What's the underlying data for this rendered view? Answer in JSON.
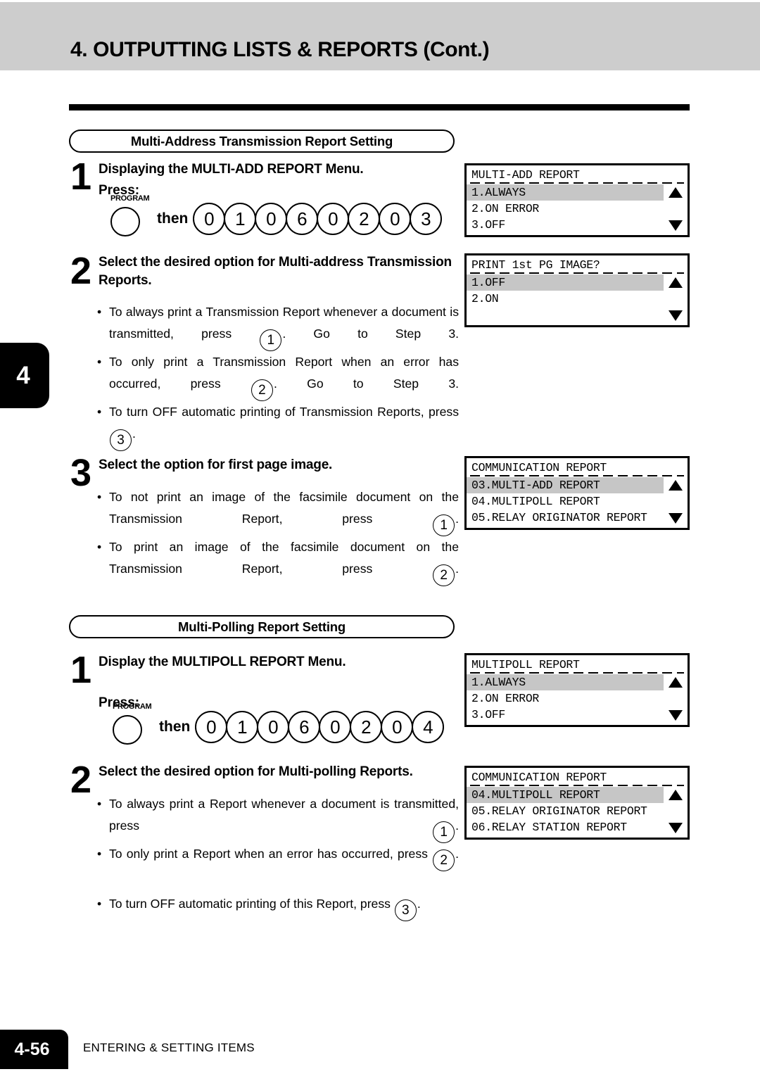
{
  "header": {
    "title": "4. OUTPUTTING LISTS & REPORTS (Cont.)"
  },
  "chapter_tab": "4",
  "sections": [
    {
      "pill_label": "Multi-Address Transmission Report Setting",
      "steps": [
        {
          "number": "1",
          "heading": "Displaying the MULTI-ADD REPORT Menu.",
          "press_label": "Press:",
          "program_key_label": "PROGRAM",
          "then_label": "then",
          "key_sequence": [
            "0",
            "1",
            "0",
            "6",
            "0",
            "2",
            "0",
            "3"
          ]
        },
        {
          "number": "2",
          "heading": "Select the desired option for Multi-address Transmission Reports.",
          "bullets": [
            {
              "pre": "To always print a Transmission Report whenever a document is transmitted, press ",
              "key": "1",
              "post": ".  Go to Step 3."
            },
            {
              "pre": "To only print a Transmission Report when an error has occurred, press ",
              "key": "2",
              "post": ".  Go to Step 3."
            },
            {
              "pre": "To turn OFF automatic printing of Transmission Reports, press ",
              "key": "3",
              "post": "."
            }
          ]
        },
        {
          "number": "3",
          "heading": "Select the option for first page image.",
          "bullets": [
            {
              "pre": "To not print an image of the facsimile document on the Transmission Report, press ",
              "key": "1",
              "post": "."
            },
            {
              "pre": "To print an image of the facsimile document on the Transmission Report, press ",
              "key": "2",
              "post": "."
            }
          ]
        }
      ]
    },
    {
      "pill_label": "Multi-Polling Report Setting",
      "steps": [
        {
          "number": "1",
          "heading": "Display the MULTIPOLL REPORT Menu.",
          "press_label": "Press:",
          "program_key_label": "PROGRAM",
          "then_label": "then",
          "key_sequence": [
            "0",
            "1",
            "0",
            "6",
            "0",
            "2",
            "0",
            "4"
          ]
        },
        {
          "number": "2",
          "heading": "Select the desired option for Multi-polling Reports.",
          "bullets": [
            {
              "pre": "To always print a Report whenever a document is transmitted, press ",
              "key": "1",
              "post": "."
            },
            {
              "pre": "To only print a Report when an error has occurred, press ",
              "key": "2",
              "post": "."
            },
            {
              "pre": "To turn OFF automatic printing of this Report, press ",
              "key": "3",
              "post": "."
            }
          ]
        }
      ]
    }
  ],
  "lcd_panels": [
    {
      "title": "MULTI-ADD REPORT",
      "rows": [
        {
          "text": "1.ALWAYS",
          "selected": true
        },
        {
          "text": "2.ON ERROR",
          "selected": false
        },
        {
          "text": "3.OFF",
          "selected": false
        }
      ],
      "scroll_up_icon": "triangle-up",
      "scroll_down_icon": "triangle-down"
    },
    {
      "title": "PRINT 1st PG IMAGE?",
      "rows": [
        {
          "text": "1.OFF",
          "selected": true
        },
        {
          "text": "2.ON",
          "selected": false
        },
        {
          "text": "",
          "selected": false
        }
      ],
      "scroll_up_icon": "triangle-up",
      "scroll_down_icon": "triangle-down"
    },
    {
      "title": "COMMUNICATION REPORT",
      "rows": [
        {
          "text": "03.MULTI-ADD REPORT",
          "selected": true
        },
        {
          "text": "04.MULTIPOLL REPORT",
          "selected": false
        },
        {
          "text": "05.RELAY ORIGINATOR REPORT",
          "selected": false
        }
      ],
      "scroll_up_icon": "triangle-up",
      "scroll_down_icon": "triangle-down"
    },
    {
      "title": "MULTIPOLL REPORT",
      "rows": [
        {
          "text": "1.ALWAYS",
          "selected": true
        },
        {
          "text": "2.ON ERROR",
          "selected": false
        },
        {
          "text": "3.OFF",
          "selected": false
        }
      ],
      "scroll_up_icon": "triangle-up",
      "scroll_down_icon": "triangle-down"
    },
    {
      "title": "COMMUNICATION REPORT",
      "rows": [
        {
          "text": "04.MULTIPOLL REPORT",
          "selected": true
        },
        {
          "text": "05.RELAY ORIGINATOR REPORT",
          "selected": false
        },
        {
          "text": "06.RELAY STATION REPORT",
          "selected": false
        }
      ],
      "scroll_up_icon": "triangle-up",
      "scroll_down_icon": "triangle-down"
    }
  ],
  "footer": {
    "page_number": "4-56",
    "running_title": "ENTERING & SETTING ITEMS"
  }
}
